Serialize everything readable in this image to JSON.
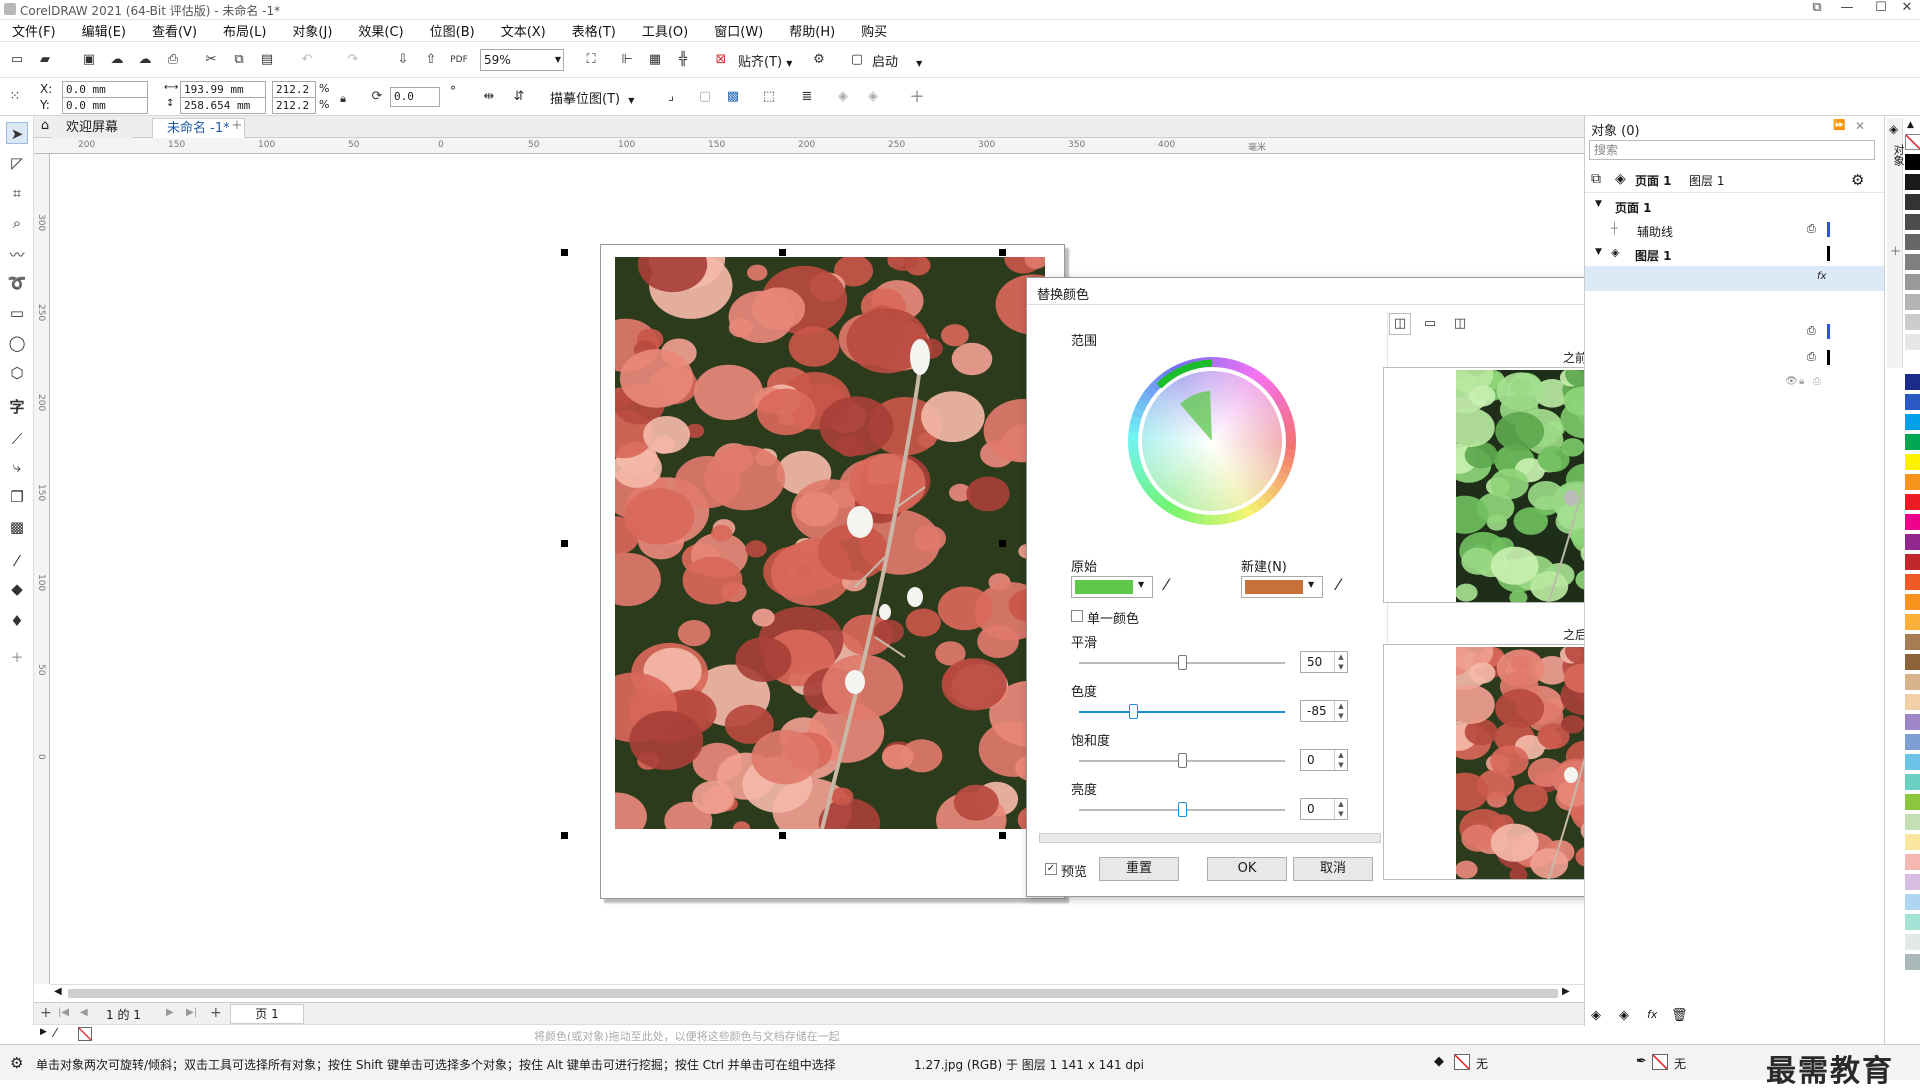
{
  "window": {
    "title": "CorelDRAW 2021 (64-Bit 评估版) - 未命名 -1*"
  },
  "menu": [
    "文件(F)",
    "编辑(E)",
    "查看(V)",
    "布局(L)",
    "对象(J)",
    "效果(C)",
    "位图(B)",
    "文本(X)",
    "表格(T)",
    "工具(O)",
    "窗口(W)",
    "帮助(H)",
    "购买"
  ],
  "toolbar": {
    "zoom": "59%",
    "snap_label": "贴齐(T)",
    "launch_label": "启动"
  },
  "propbar": {
    "x": "0.0 mm",
    "y": "0.0 mm",
    "w": "193.99 mm",
    "h": "258.654 mm",
    "sx": "212.2",
    "sy": "212.2",
    "pct": "%",
    "rotation": "0.0",
    "deg": "°",
    "trace_label": "描摹位图(T)"
  },
  "tabs": [
    "欢迎屏幕",
    "未命名 -1*"
  ],
  "ruler_h_ticks": [
    "200",
    "150",
    "100",
    "50",
    "0",
    "50",
    "100",
    "150",
    "200",
    "250",
    "300",
    "350",
    "400",
    "毫米"
  ],
  "ruler_v_ticks": [
    "300",
    "250",
    "200",
    "150",
    "100",
    "50",
    "0"
  ],
  "pagenav": {
    "counter": "1 的 1",
    "page_tab": "页 1"
  },
  "colorrow_hint": "将颜色(或对象)拖动至此处，以便将这些颜色与文档存储在一起",
  "status": {
    "hint": "单击对象两次可旋转/倾斜；双击工具可选择所有对象；按住 Shift 键单击可选择多个对象；按住 Alt 键单击可进行挖掘；按住 Ctrl 并单击可在组中选择",
    "object_info": "1.27.jpg (RGB) 于 图层 1 141 x 141 dpi",
    "fill_none": "无",
    "outline_none": "无"
  },
  "dialog": {
    "title": "替换颜色",
    "range_label": "范围",
    "original_label": "原始",
    "new_label": "新建(N)",
    "single_color_label": "单一颜色",
    "smooth_label": "平滑",
    "hue_label": "色度",
    "saturation_label": "饱和度",
    "brightness_label": "亮度",
    "smooth": {
      "value": "50",
      "level": 0.5
    },
    "hue": {
      "value": "-85",
      "level": 0.26
    },
    "saturation": {
      "value": "0",
      "level": 0.5
    },
    "brightness": {
      "value": "0",
      "level": 0.5
    },
    "before_label": "之前",
    "after_label": "之后",
    "preview_label": "预览",
    "reset_label": "重置",
    "ok_label": "OK",
    "cancel_label": "取消",
    "preview_checked": true,
    "colors": {
      "original": "#5ec84a",
      "new": "#c8703a"
    }
  },
  "objects_panel": {
    "title": "对象 (0)",
    "search_placeholder": "搜索",
    "page_label": "页面 1",
    "layer_label": "图层 1",
    "tree": [
      "页面 1",
      "辅助线",
      "图层 1"
    ],
    "side_tab": "对象"
  },
  "watermark": "最需教育",
  "palette_colors": [
    "#000000",
    "#1a1a1a",
    "#333333",
    "#4d4d4d",
    "#666666",
    "#808080",
    "#999999",
    "#b3b3b3",
    "#cccccc",
    "#e6e6e6",
    "#ffffff",
    "#1c2a8a",
    "#2b59c3",
    "#00a0e9",
    "#00a651",
    "#fff200",
    "#f7941d",
    "#ed1c24",
    "#ec008c",
    "#92278f",
    "#c1272d",
    "#f15a24",
    "#f7931e",
    "#fbb03b",
    "#a67c52",
    "#8c6239",
    "#d9b38c",
    "#f2d0a7",
    "#9e86c8",
    "#7f9fd4",
    "#6cc3e8",
    "#6ad1c2",
    "#8cc63f",
    "#c5e0b4",
    "#f9e79f",
    "#f5b7b1",
    "#d7bde2",
    "#aed6f1",
    "#a3e4d7",
    "#e5e8e8",
    "#aab7b8"
  ]
}
